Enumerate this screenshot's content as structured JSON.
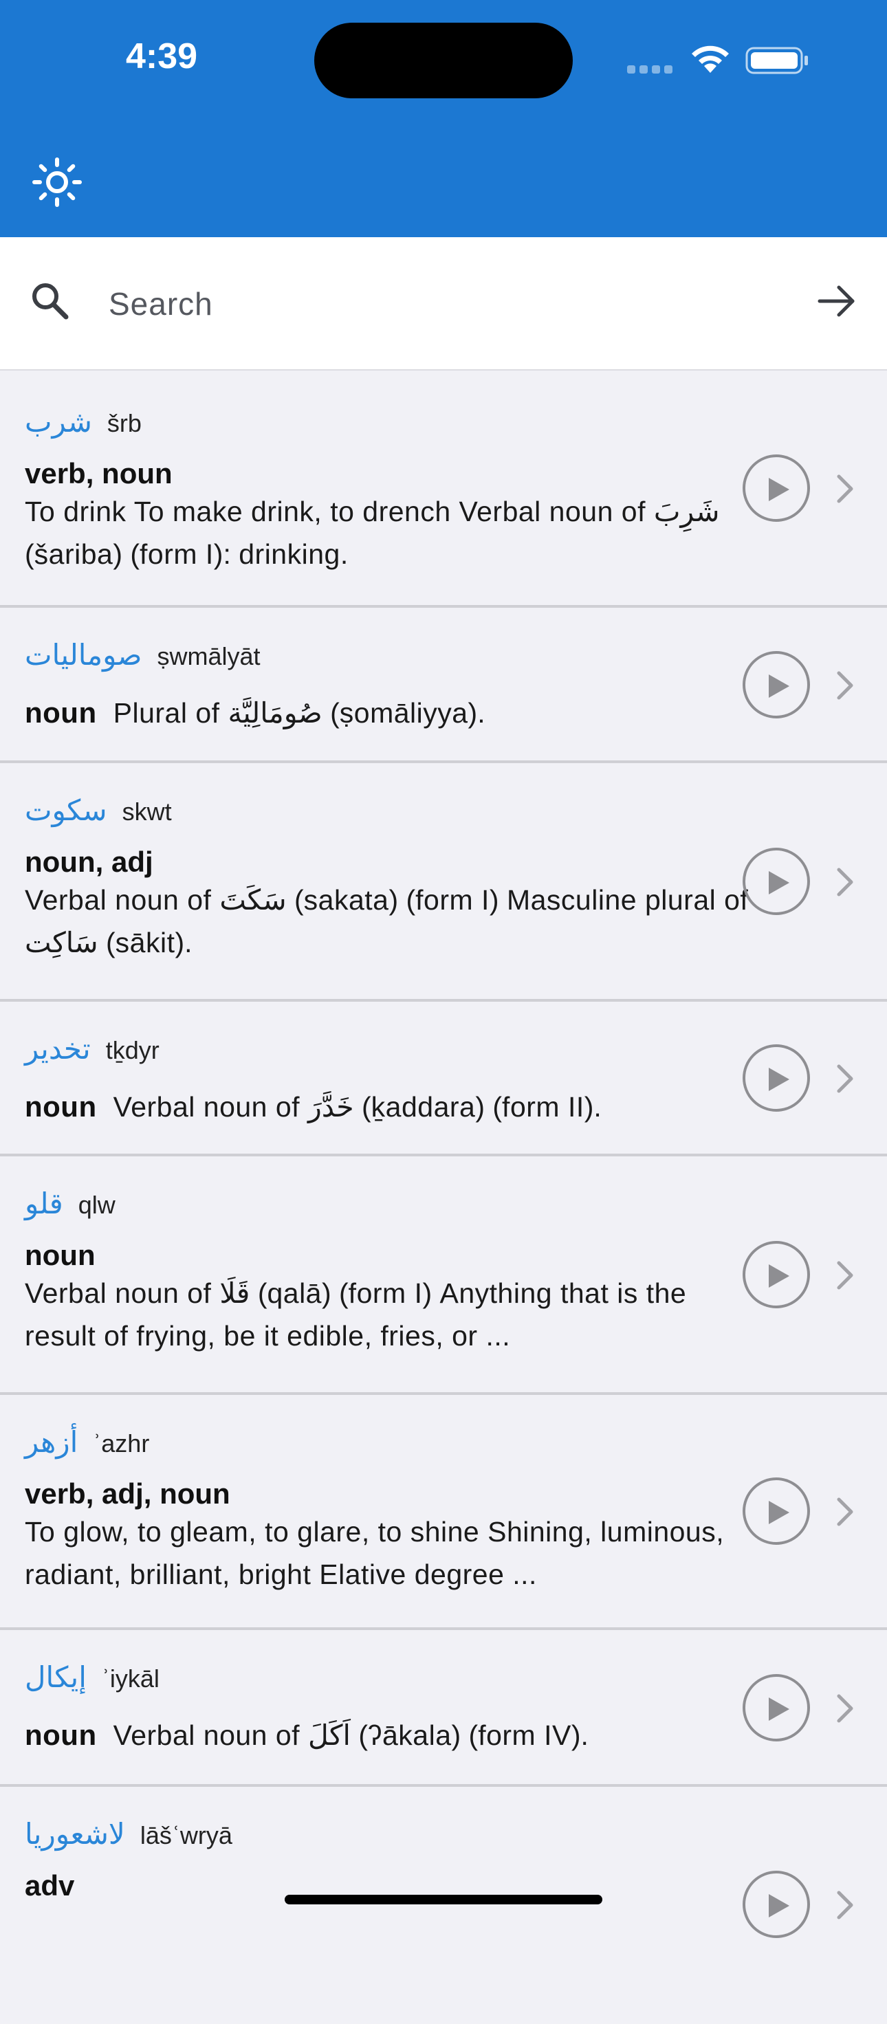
{
  "status_bar": {
    "time": "4:39"
  },
  "search": {
    "placeholder": "Search"
  },
  "entries": [
    {
      "arabic": "شرب",
      "translit": "šrb",
      "pos": "verb, noun",
      "definition": "To drink To make drink, to drench Verbal noun of شَرِبَ (šariba) (form I): drinking."
    },
    {
      "arabic": "صوماليات",
      "translit": "ṣwmālyāt",
      "pos": "noun",
      "definition": "Plural of صُومَالِيَّة (ṣomāliyya)."
    },
    {
      "arabic": "سكوت",
      "translit": "skwt",
      "pos": "noun, adj",
      "definition": "Verbal noun of سَكَتَ (sakata) (form I) Masculine plural of سَاكِت (sākit)."
    },
    {
      "arabic": "تخدير",
      "translit": "tḵdyr",
      "pos": "noun",
      "definition": "Verbal noun of خَدَّرَ (ḵaddara) (form II)."
    },
    {
      "arabic": "قلو",
      "translit": "qlw",
      "pos": "noun",
      "definition": "Verbal noun of قَلَا (qalā) (form I) Anything that is the result of frying, be it edible, fries, or ..."
    },
    {
      "arabic": "أزهر",
      "translit": "ʾazhr",
      "pos": "verb, adj, noun",
      "definition": "To glow, to gleam, to glare, to shine Shining, luminous, radiant, brilliant, bright Elative degree ..."
    },
    {
      "arabic": "إيكال",
      "translit": "ʾiykāl",
      "pos": "noun",
      "definition": "Verbal noun of اَكَلَ (ʔākala) (form IV)."
    },
    {
      "arabic": "لاشعوريا",
      "translit": "lāšʿwryā",
      "pos": "adv",
      "definition": ""
    }
  ]
}
